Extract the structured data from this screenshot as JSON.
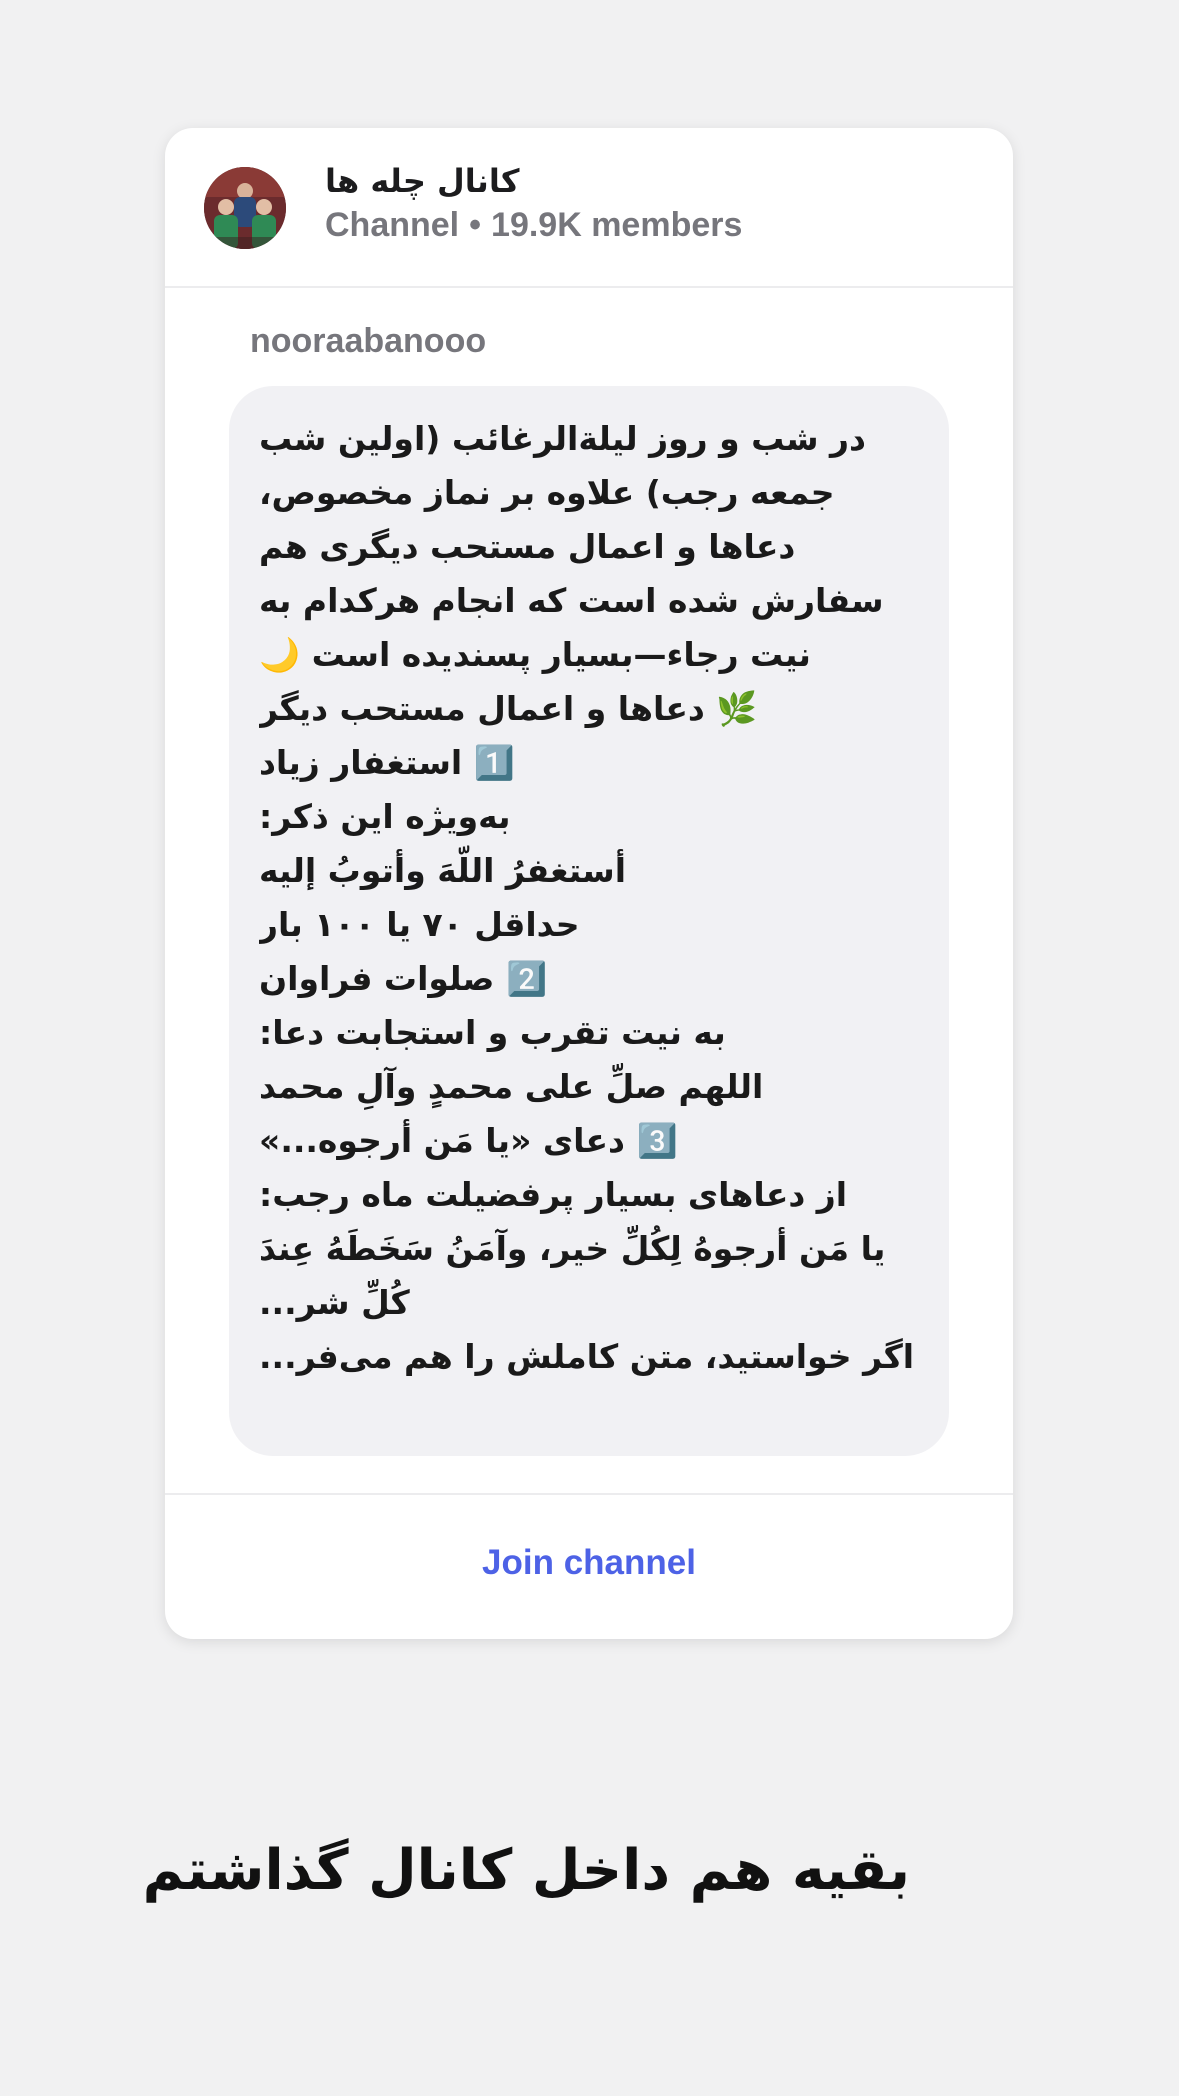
{
  "channel": {
    "title": "کانال چله ها",
    "type_label": "Channel",
    "separator": "•",
    "members": "19.9K members",
    "avatar_icon": "channel-avatar-photo"
  },
  "message": {
    "author": "nooraabanooo",
    "lines": [
      "در شب و روز لیلة‌الرغائب (اولین شب",
      "جمعه رجب) علاوه بر نماز مخصوص،",
      "دعاها و اعمال مستحب دیگری هم",
      "سفارش شده است که انجام هرکدام به",
      "نیت رجاء—بسیار پسندیده است 🌙",
      "🌿 دعاها و اعمال مستحب دیگر",
      "1️⃣ استغفار زیاد",
      "به‌ویژه این ذکر:",
      "أستغفرُ اللّهَ وأتوبُ إلیه",
      "حداقل ۷۰ یا ۱۰۰ بار",
      "2️⃣ صلوات فراوان",
      "به نیت تقرب و استجابت دعا:",
      "اللهم صلِّ علی محمدٍ وآلِ محمد",
      "3️⃣ دعای «یا مَن أرجوه...»",
      "از دعاهای بسیار پرفضیلت ماه رجب:",
      "یا مَن أرجوهُ لِکُلِّ خیر، وآمَنُ سَخَطَهُ عِندَ",
      "کُلِّ شر...",
      "اگر خواستید، متن کاملش را هم می‌فر..."
    ]
  },
  "footer": {
    "join_label": "Join channel"
  },
  "caption": "بقیه هم داخل کانال گذاشتم",
  "colors": {
    "background": "#f1f1f2",
    "card": "#ffffff",
    "bubble": "#f1f1f4",
    "accent": "#4d62e6",
    "muted": "#76767c"
  }
}
